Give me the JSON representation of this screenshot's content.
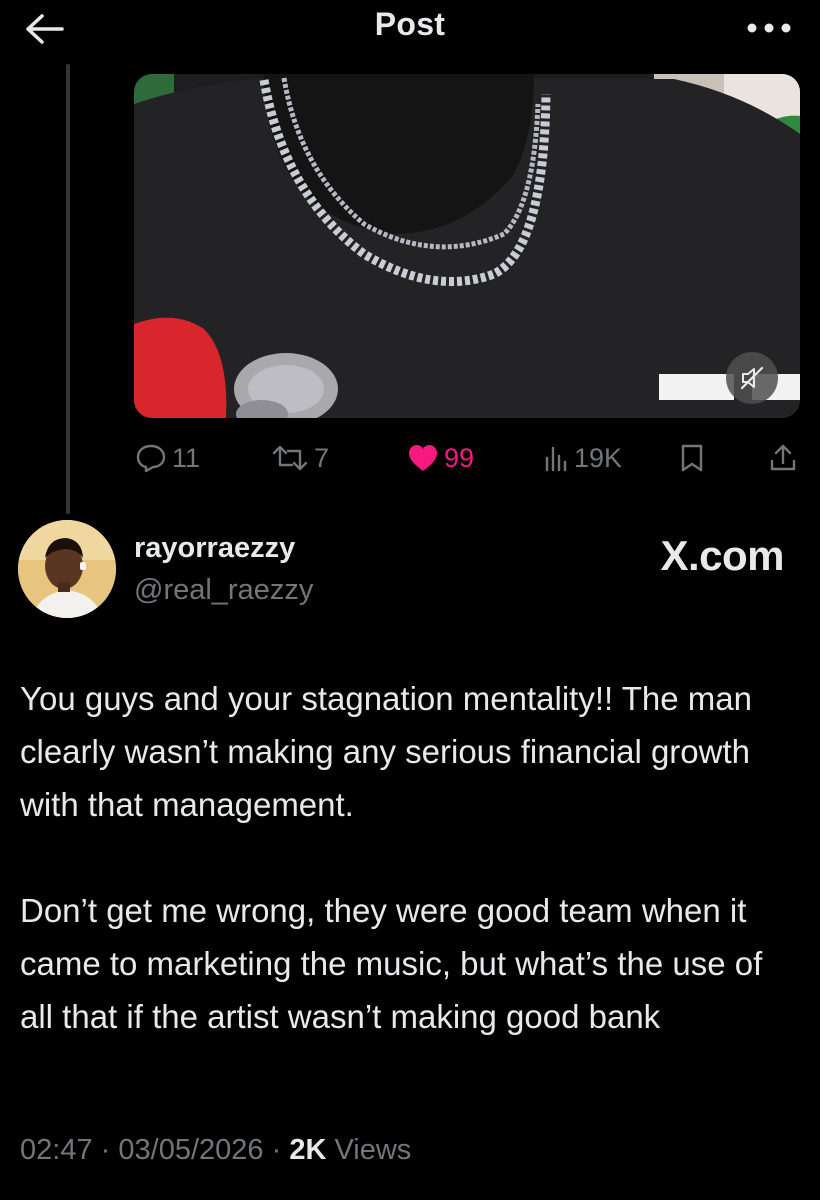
{
  "header": {
    "title": "Post",
    "back_icon": "arrow-left-icon",
    "more_icon": "more-horizontal-icon"
  },
  "media": {
    "type": "video",
    "mute_icon": "speaker-muted-icon"
  },
  "actions": {
    "replies": "11",
    "reposts": "7",
    "likes": "99",
    "views": "19K",
    "like_color": "#f91880",
    "muted_color": "#71767b"
  },
  "author": {
    "display_name": "rayorraezzy",
    "handle": "@real_raezzy"
  },
  "watermark": "X.com",
  "tweet": {
    "paragraphs": [
      "You guys and your stagnation mentality!! The man clearly wasn’t making any serious financial growth with that management.",
      "Don’t get me wrong, they were good team when it came to marketing the music, but what’s the use of all that if the artist wasn’t making good bank"
    ]
  },
  "meta": {
    "time": "02:47",
    "date": "03/05/2026",
    "views_count": "2K",
    "views_label": "Views",
    "separator": "·"
  }
}
